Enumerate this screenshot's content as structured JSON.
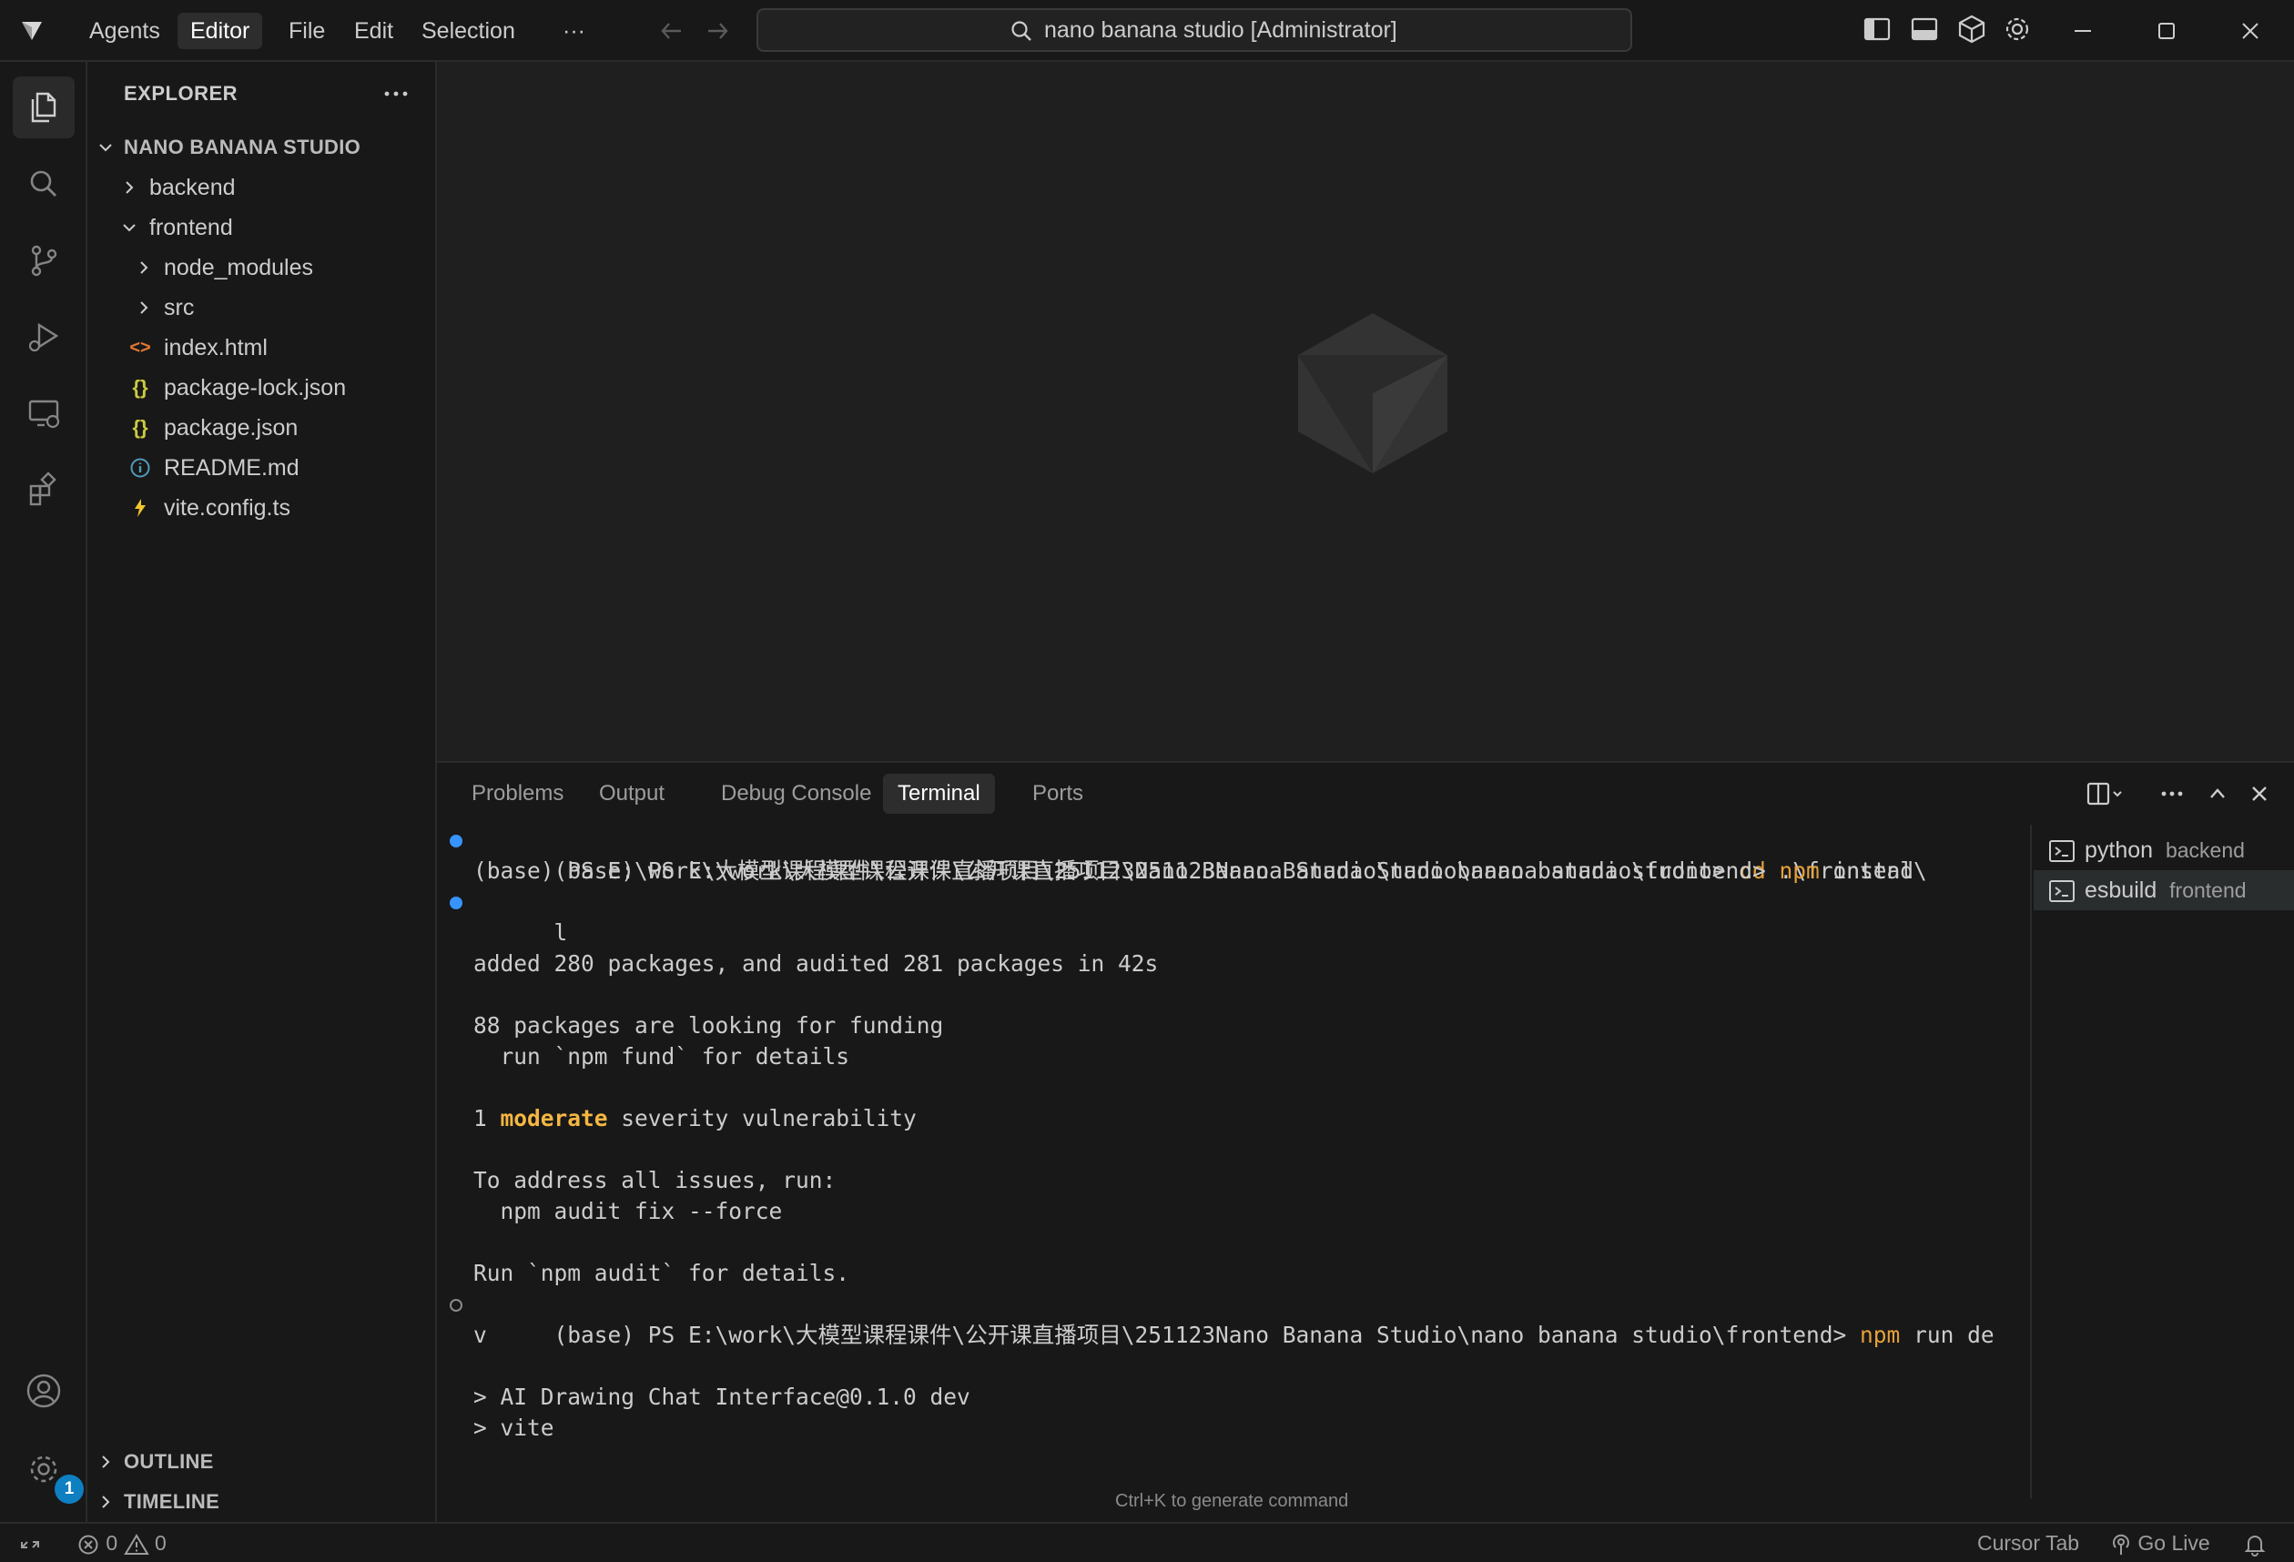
{
  "titlebar": {
    "menus": [
      "Agents",
      "Editor",
      "File",
      "Edit",
      "Selection"
    ],
    "more_label": "···",
    "search_text": "nano banana studio [Administrator]"
  },
  "explorer": {
    "title": "EXPLORER",
    "root": "NANO BANANA STUDIO",
    "items": [
      {
        "label": "backend",
        "icon": "chevron-right-icon"
      },
      {
        "label": "frontend",
        "icon": "chevron-down-icon"
      },
      {
        "label": "node_modules",
        "icon": "chevron-right-icon"
      },
      {
        "label": "src",
        "icon": "chevron-right-icon"
      },
      {
        "label": "index.html",
        "icon": "html-file-icon"
      },
      {
        "label": "package-lock.json",
        "icon": "json-file-icon"
      },
      {
        "label": "package.json",
        "icon": "json-file-icon"
      },
      {
        "label": "README.md",
        "icon": "info-file-icon"
      },
      {
        "label": "vite.config.ts",
        "icon": "vite-file-icon"
      }
    ],
    "outline": "OUTLINE",
    "timeline": "TIMELINE"
  },
  "activity": {
    "accounts_badge": "1"
  },
  "panel": {
    "tabs": [
      "Problems",
      "Output",
      "Debug Console",
      "Terminal",
      "Ports"
    ],
    "terminals": [
      {
        "name": "python",
        "sub": "backend"
      },
      {
        "name": "esbuild",
        "sub": "frontend"
      }
    ],
    "hint": "Ctrl+K to generate command"
  },
  "terminal": {
    "l1_prefix": "(base) PS E:\\work\\大模型课程课件\\公开课直播项目\\251123Nano Banana Studio\\nano banana studio> ",
    "l1_cmd": "cd",
    "l1_rest": " .\\frontend\\",
    "l2_prefix": "(base) PS E:\\work\\大模型课程课件\\公开课直播项目\\251123Nano Banana Studio\\nano banana studio\\frontend> ",
    "l2_cmd": "npm",
    "l2_rest": " instal",
    "l3": "l",
    "l4": "added 280 packages, and audited 281 packages in 42s",
    "l5": "88 packages are looking for funding",
    "l6": "  run `npm fund` for details",
    "l7_pre": "1 ",
    "l7_word": "moderate",
    "l7_post": " severity vulnerability",
    "l8": "To address all issues, run:",
    "l9": "  npm audit fix --force",
    "l10": "Run `npm audit` for details.",
    "l11_prefix": "(base) PS E:\\work\\大模型课程课件\\公开课直播项目\\251123Nano Banana Studio\\nano banana studio\\frontend> ",
    "l11_cmd": "npm",
    "l11_rest": " run de",
    "l12": "v",
    "l13": "> AI Drawing Chat Interface@0.1.0 dev",
    "l14": "> vite"
  },
  "statusbar": {
    "errors": "0",
    "warnings": "0",
    "cursor_tab": "Cursor Tab",
    "go_live": "Go Live"
  },
  "colors": {
    "accent": "#0e7fc1",
    "terminal_command": "#e5a03a",
    "background": "#181818",
    "editor": "#1f1f1f"
  }
}
